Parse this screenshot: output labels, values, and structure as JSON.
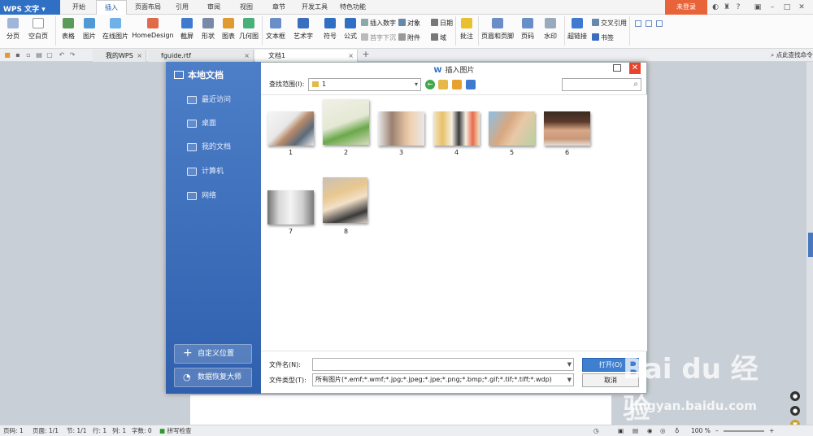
{
  "app": {
    "name": "WPS 文字",
    "login": "未登录"
  },
  "menu_tabs": [
    "开始",
    "插入",
    "页面布局",
    "引用",
    "审阅",
    "视图",
    "章节",
    "开发工具",
    "特色功能"
  ],
  "ribbon": {
    "big": [
      "分页",
      "空白页",
      "表格",
      "图片",
      "在线图片",
      "HomeDesign",
      "截屏",
      "形状",
      "图表",
      "几何图",
      "文本框",
      "艺术字",
      "符号",
      "公式"
    ],
    "small": [
      "插入数字",
      "对象",
      "日期",
      "首字下沉",
      "附件",
      "域"
    ],
    "big2": [
      "批注",
      "页眉和页脚",
      "页码",
      "水印",
      "超链接"
    ],
    "small2": [
      "交叉引用",
      "书签"
    ]
  },
  "doc_tabs": [
    "我的WPS",
    "fguide.rtf",
    "文档1"
  ],
  "quick_search": "点此查找命令",
  "dialog": {
    "title": "插入图片",
    "sidebar_title": "本地文档",
    "nav": [
      "最近访问",
      "桌面",
      "我的文档",
      "计算机",
      "网络"
    ],
    "custom_location": "自定义位置",
    "recovery": "数据恢复大师",
    "look_in_label": "查找范围(I):",
    "look_in_value": "1",
    "files": [
      "1",
      "2",
      "3",
      "4",
      "5",
      "6",
      "7",
      "8"
    ],
    "filename_label": "文件名(N):",
    "filename_value": "",
    "filetype_label": "文件类型(T):",
    "filetype_value": "所有图片(*.emf;*.wmf;*.jpg;*.jpeg;*.jpe;*.png;*.bmp;*.gif;*.tif;*.tiff;*.wdp)",
    "open": "打开(O)",
    "cancel": "取消"
  },
  "status": {
    "page": "页码: 1",
    "pages": "页面: 1/1",
    "section": "节: 1/1",
    "row": "行: 1",
    "col": "列: 1",
    "words": "字数: 0",
    "spell": "拼写检查",
    "zoom": "100 %"
  },
  "watermark": {
    "logo": "Bai du 经验",
    "url": "jingyan.baidu.com"
  },
  "colors": {
    "accent": "#2f6fc4",
    "sidebar": "#3b6cb8",
    "close": "#e8442b",
    "login": "#e8633a"
  }
}
